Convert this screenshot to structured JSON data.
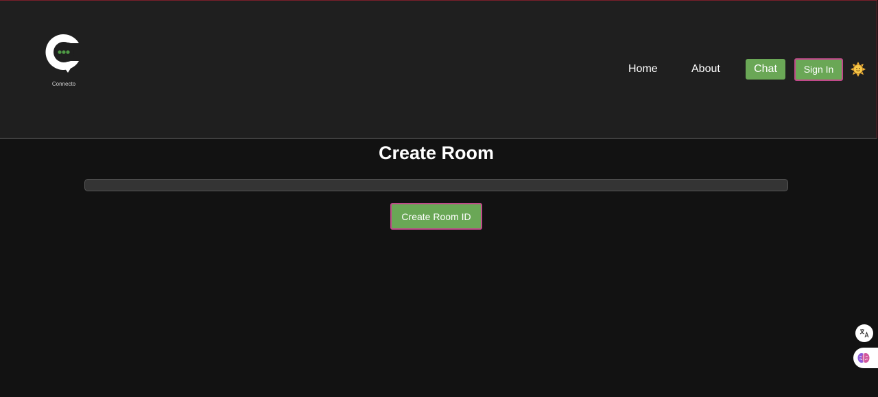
{
  "header": {
    "logo_text": "Connecto",
    "nav": {
      "home": "Home",
      "about": "About",
      "chat": "Chat",
      "sign_in": "Sign In"
    },
    "theme_icon": "sun-icon"
  },
  "main": {
    "title": "Create Room",
    "room_input": {
      "value": "",
      "placeholder": ""
    },
    "create_button": "Create Room ID"
  },
  "widgets": {
    "translate_icon": "translate-icon",
    "brain_icon": "brain-icon"
  },
  "colors": {
    "accent_green": "#6aa756",
    "border_pink": "#c0498a",
    "header_bg": "#1f1f1f",
    "page_bg": "#121212"
  }
}
